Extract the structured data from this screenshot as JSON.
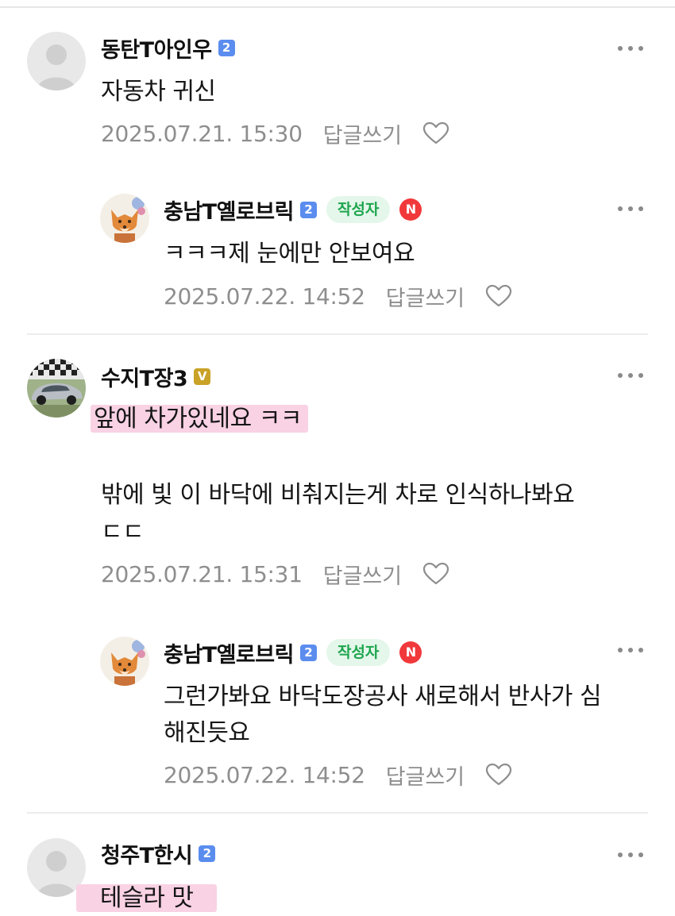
{
  "comments": [
    {
      "nick": "동탄T아인우",
      "grade": "2",
      "text": "자동차 귀신",
      "date": "2025.07.21. 15:30",
      "reply_label": "답글쓰기",
      "avatar": "default-avatar"
    },
    {
      "nick": "충남T옐로브릭",
      "grade": "2",
      "author_badge": "작성자",
      "n_badge": "N",
      "text": "ㅋㅋㅋ제 눈에만 안보여요",
      "date": "2025.07.22. 14:52",
      "reply_label": "답글쓰기",
      "avatar": "fox-avatar"
    },
    {
      "nick": "수지T장3",
      "grade": "V",
      "text_line1": "앞에 차가있네요 ㅋㅋ",
      "text_line2": "밖에 빛 이 바닥에 비춰지는게 차로 인식하나봐요",
      "text_line3": "ㄷㄷ",
      "date": "2025.07.21. 15:31",
      "reply_label": "답글쓰기",
      "avatar": "car-avatar"
    },
    {
      "nick": "충남T옐로브릭",
      "grade": "2",
      "author_badge": "작성자",
      "n_badge": "N",
      "text_line1": "그런가봐요 바닥도장공사 새로해서 반사가 심",
      "text_line2": "해진듯요",
      "date": "2025.07.22. 14:52",
      "reply_label": "답글쓰기",
      "avatar": "fox-avatar"
    },
    {
      "nick": "청주T한시",
      "grade": "2",
      "text": "테슬라 맛",
      "avatar": "default-avatar"
    }
  ],
  "colors": {
    "grade_blue": "#5b8def",
    "grade_gold": "#c9a227",
    "author_badge_bg": "#e4f7ea",
    "author_badge_text": "#1fa54e",
    "n_badge": "#f1393b",
    "highlight": "#f9d2e4",
    "meta_text": "#8e8e8e"
  },
  "icons": [
    "more-icon",
    "heart-icon",
    "default-avatar",
    "fox-avatar",
    "car-avatar"
  ]
}
